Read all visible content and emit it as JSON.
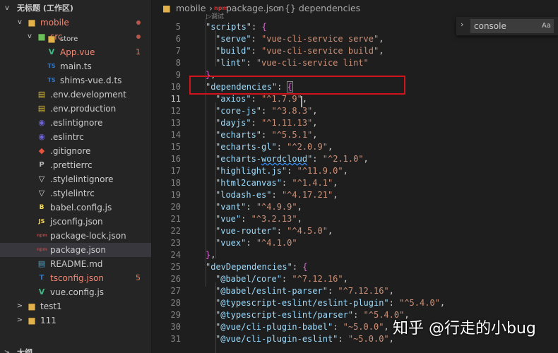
{
  "sidebar": {
    "workspace_title": "无标题 (工作区)",
    "items": [
      {
        "label": "mobile",
        "chev": "v",
        "icon": "folder-icon",
        "color": "#f48771",
        "badge": "dot"
      },
      {
        "label": "src",
        "chev": "v",
        "icon": "folder-src-icon",
        "color": "#f48771",
        "badge": "dot"
      },
      {
        "label": "store",
        "chev": "",
        "icon": "folder-icon",
        "color": "#cccccc"
      },
      {
        "label": "App.vue",
        "icon": "vue-icon",
        "color": "#f48771",
        "badge": "1"
      },
      {
        "label": "main.ts",
        "icon": "typescript-icon",
        "color": "#cccccc"
      },
      {
        "label": "shims-vue.d.ts",
        "icon": "typescript-icon",
        "color": "#cccccc"
      },
      {
        "label": ".env.development",
        "icon": "env-icon",
        "color": "#cccccc"
      },
      {
        "label": ".env.production",
        "icon": "env-icon",
        "color": "#cccccc"
      },
      {
        "label": ".eslintignore",
        "icon": "eslint-icon",
        "color": "#cccccc"
      },
      {
        "label": ".eslintrc",
        "icon": "eslint-icon",
        "color": "#cccccc"
      },
      {
        "label": ".gitignore",
        "icon": "git-icon",
        "color": "#cccccc"
      },
      {
        "label": ".prettierrc",
        "icon": "prettier-icon",
        "color": "#cccccc"
      },
      {
        "label": ".stylelintignore",
        "icon": "stylelint-icon",
        "color": "#cccccc"
      },
      {
        "label": ".stylelintrc",
        "icon": "stylelint-icon",
        "color": "#cccccc"
      },
      {
        "label": "babel.config.js",
        "icon": "babel-icon",
        "color": "#cccccc"
      },
      {
        "label": "jsconfig.json",
        "icon": "js-icon",
        "color": "#cccccc"
      },
      {
        "label": "package-lock.json",
        "icon": "npm-icon",
        "color": "#cccccc"
      },
      {
        "label": "package.json",
        "icon": "npm-icon",
        "color": "#cccccc",
        "selected": true
      },
      {
        "label": "README.md",
        "icon": "readme-icon",
        "color": "#cccccc"
      },
      {
        "label": "tsconfig.json",
        "icon": "tsconfig-icon",
        "color": "#f48771",
        "badge": "5"
      },
      {
        "label": "vue.config.js",
        "icon": "vue-icon",
        "color": "#cccccc"
      },
      {
        "label": "test1",
        "chev": ">",
        "icon": "folder-icon",
        "color": "#cccccc"
      },
      {
        "label": "111",
        "chev": ">",
        "icon": "folder-icon",
        "color": "#cccccc"
      }
    ],
    "outline_title": "大纲"
  },
  "breadcrumb": {
    "folder": "mobile",
    "file": "package.json",
    "symbol": "{} dependencies",
    "sticky": "调试"
  },
  "find": {
    "value": "console",
    "case_label": "Aa"
  },
  "editor": {
    "active_line": "11",
    "lines": [
      {
        "n": "5",
        "tokens": [
          [
            "k",
            "\"scripts\""
          ],
          [
            "p",
            ": "
          ],
          [
            "b2",
            "{"
          ]
        ]
      },
      {
        "n": "6",
        "tokens": [
          [
            "k",
            "\"serve\""
          ],
          [
            "p",
            ": "
          ],
          [
            "s",
            "\"vue-cli-service serve\""
          ],
          [
            "p",
            ","
          ]
        ]
      },
      {
        "n": "7",
        "tokens": [
          [
            "k",
            "\"build\""
          ],
          [
            "p",
            ": "
          ],
          [
            "s",
            "\"vue-cli-service build\""
          ],
          [
            "p",
            ","
          ]
        ]
      },
      {
        "n": "8",
        "tokens": [
          [
            "k",
            "\"lint\""
          ],
          [
            "p",
            ": "
          ],
          [
            "s",
            "\"vue-cli-service lint\""
          ]
        ]
      },
      {
        "n": "9",
        "tokens": [
          [
            "b2",
            "}"
          ],
          [
            "p",
            ","
          ]
        ]
      },
      {
        "n": "10",
        "tokens": [
          [
            "k",
            "\"dependencies\""
          ],
          [
            "p",
            ": "
          ],
          [
            "b2",
            "{"
          ]
        ]
      },
      {
        "n": "11",
        "tokens": [
          [
            "k",
            "\"axios\""
          ],
          [
            "p",
            ": "
          ],
          [
            "s",
            "\"^1.7.9\""
          ],
          [
            "p",
            ","
          ]
        ]
      },
      {
        "n": "12",
        "tokens": [
          [
            "k",
            "\"core-js\""
          ],
          [
            "p",
            ": "
          ],
          [
            "s",
            "\"^3.8.3\""
          ],
          [
            "p",
            ","
          ]
        ]
      },
      {
        "n": "13",
        "tokens": [
          [
            "k",
            "\"dayjs\""
          ],
          [
            "p",
            ": "
          ],
          [
            "s",
            "\"^1.11.13\""
          ],
          [
            "p",
            ","
          ]
        ]
      },
      {
        "n": "14",
        "tokens": [
          [
            "k",
            "\"echarts\""
          ],
          [
            "p",
            ": "
          ],
          [
            "s",
            "\"^5.5.1\""
          ],
          [
            "p",
            ","
          ]
        ]
      },
      {
        "n": "15",
        "tokens": [
          [
            "k",
            "\"echarts-gl\""
          ],
          [
            "p",
            ": "
          ],
          [
            "s",
            "\"^2.0.9\""
          ],
          [
            "p",
            ","
          ]
        ]
      },
      {
        "n": "16",
        "tokens": [
          [
            "k",
            "\"echarts-"
          ],
          [
            "k squiggle",
            "wordcloud"
          ],
          [
            "k",
            "\""
          ],
          [
            "p",
            ": "
          ],
          [
            "s",
            "\"^2.1.0\""
          ],
          [
            "p",
            ","
          ]
        ]
      },
      {
        "n": "17",
        "tokens": [
          [
            "k",
            "\"highlight.js\""
          ],
          [
            "p",
            ": "
          ],
          [
            "s",
            "\"^11.9.0\""
          ],
          [
            "p",
            ","
          ]
        ]
      },
      {
        "n": "18",
        "tokens": [
          [
            "k",
            "\"html2canvas\""
          ],
          [
            "p",
            ": "
          ],
          [
            "s",
            "\"^1.4.1\""
          ],
          [
            "p",
            ","
          ]
        ]
      },
      {
        "n": "19",
        "tokens": [
          [
            "k",
            "\"lodash-es\""
          ],
          [
            "p",
            ": "
          ],
          [
            "s",
            "\"^4.17.21\""
          ],
          [
            "p",
            ","
          ]
        ]
      },
      {
        "n": "20",
        "tokens": [
          [
            "k",
            "\"vant\""
          ],
          [
            "p",
            ": "
          ],
          [
            "s",
            "\"^4.9.9\""
          ],
          [
            "p",
            ","
          ]
        ]
      },
      {
        "n": "21",
        "tokens": [
          [
            "k",
            "\"vue\""
          ],
          [
            "p",
            ": "
          ],
          [
            "s",
            "\"^3.2.13\""
          ],
          [
            "p",
            ","
          ]
        ]
      },
      {
        "n": "22",
        "tokens": [
          [
            "k",
            "\"vue-router\""
          ],
          [
            "p",
            ": "
          ],
          [
            "s",
            "\"^4.5.0\""
          ],
          [
            "p",
            ","
          ]
        ]
      },
      {
        "n": "23",
        "tokens": [
          [
            "k",
            "\"vuex\""
          ],
          [
            "p",
            ": "
          ],
          [
            "s",
            "\"^4.1.0\""
          ]
        ]
      },
      {
        "n": "24",
        "tokens": [
          [
            "b2",
            "}"
          ],
          [
            "p",
            ","
          ]
        ]
      },
      {
        "n": "25",
        "tokens": [
          [
            "k",
            "\"devDependencies\""
          ],
          [
            "p",
            ": "
          ],
          [
            "b2",
            "{"
          ]
        ]
      },
      {
        "n": "26",
        "tokens": [
          [
            "k",
            "\"@babel/core\""
          ],
          [
            "p",
            ": "
          ],
          [
            "s",
            "\"^7.12.16\""
          ],
          [
            "p",
            ","
          ]
        ]
      },
      {
        "n": "27",
        "tokens": [
          [
            "k",
            "\"@babel/eslint-parser\""
          ],
          [
            "p",
            ": "
          ],
          [
            "s",
            "\"^7.12.16\""
          ],
          [
            "p",
            ","
          ]
        ]
      },
      {
        "n": "28",
        "tokens": [
          [
            "k",
            "\"@typescript-eslint/eslint-plugin\""
          ],
          [
            "p",
            ": "
          ],
          [
            "s",
            "\"^5.4.0\""
          ],
          [
            "p",
            ","
          ]
        ]
      },
      {
        "n": "29",
        "tokens": [
          [
            "k",
            "\"@typescript-eslint/parser\""
          ],
          [
            "p",
            ": "
          ],
          [
            "s",
            "\"^5.4.0\""
          ],
          [
            "p",
            ","
          ]
        ]
      },
      {
        "n": "30",
        "tokens": [
          [
            "k",
            "\"@vue/cli-plugin-babel\""
          ],
          [
            "p",
            ": "
          ],
          [
            "s",
            "\"~5.0.0\""
          ],
          [
            "p",
            ","
          ]
        ]
      },
      {
        "n": "31",
        "tokens": [
          [
            "k",
            "\"@vue/cli-plugin-eslint\""
          ],
          [
            "p",
            ": "
          ],
          [
            "s",
            "\"~5.0.0\""
          ],
          [
            "p",
            ","
          ]
        ]
      }
    ]
  },
  "watermark": "知乎 @行走的小bug",
  "colors": {
    "background": "#1e1e1e",
    "sidebar": "#252526",
    "highlight_box": "#d0141b",
    "json_key": "#9cdcfe",
    "json_string": "#ce9178"
  }
}
